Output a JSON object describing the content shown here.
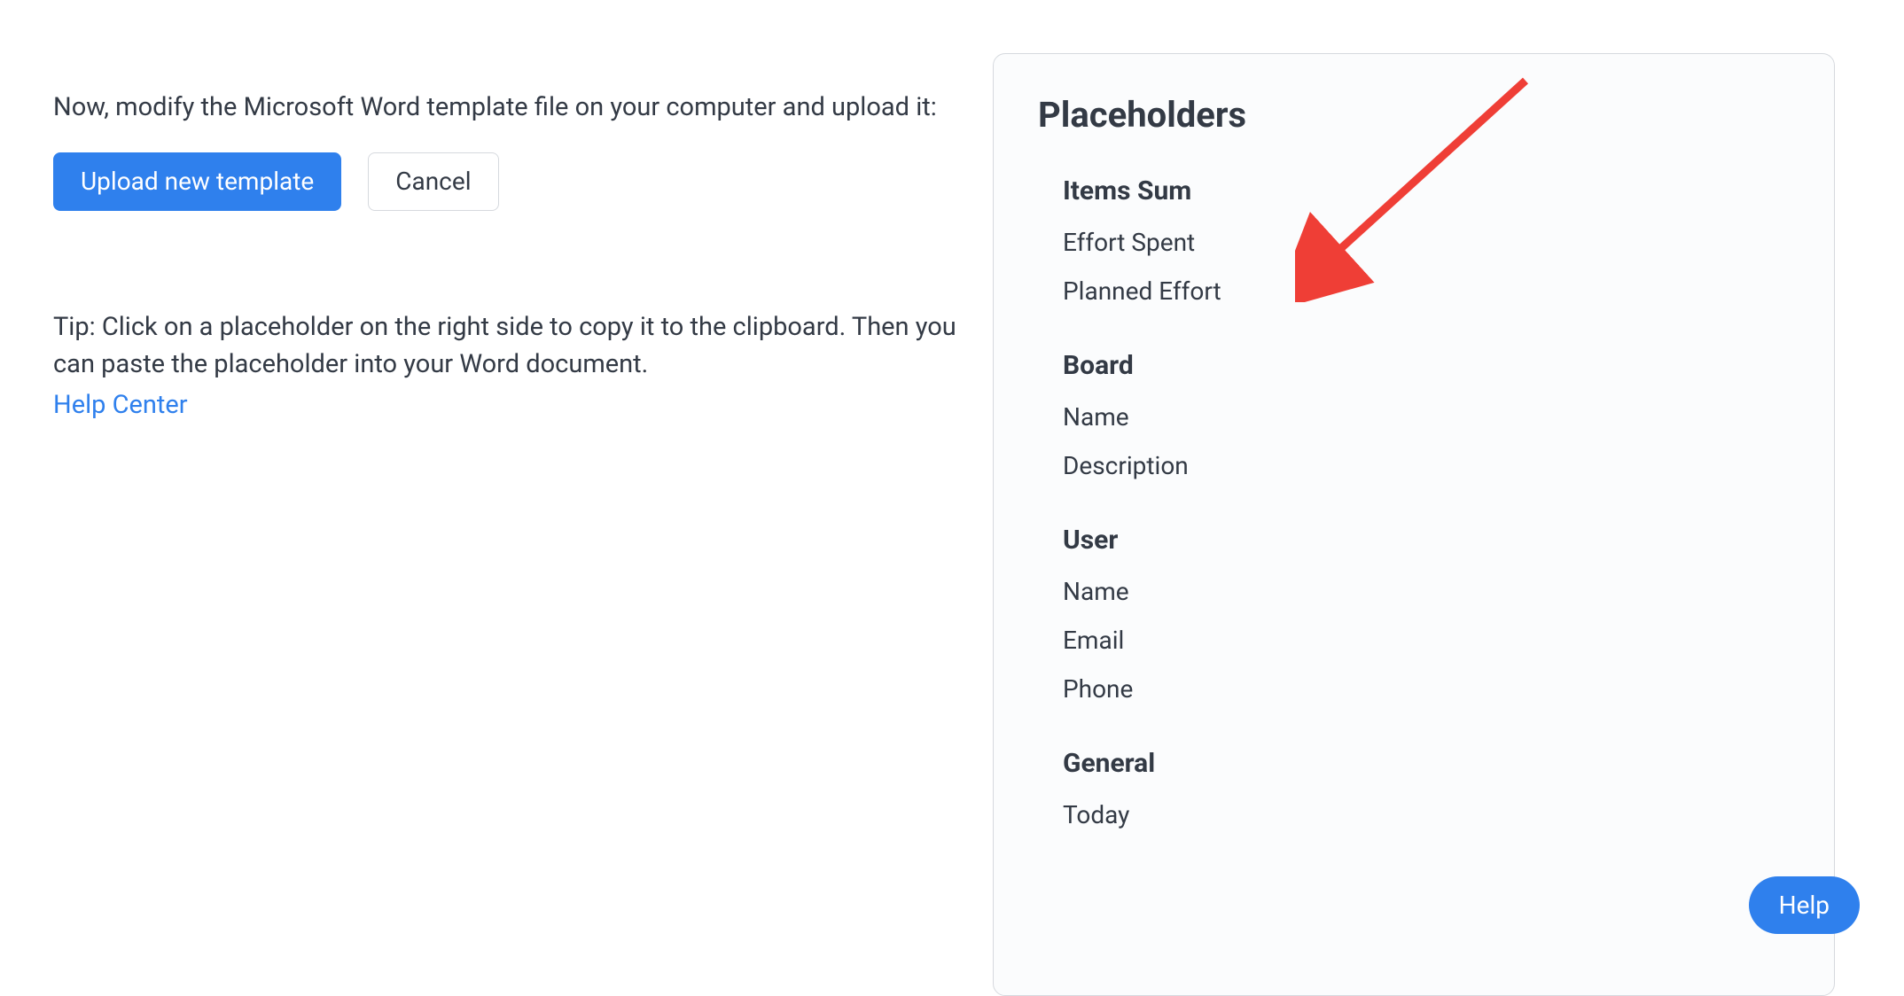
{
  "instruction": "Now, modify the Microsoft Word template file on your computer and upload it:",
  "buttons": {
    "upload": "Upload new template",
    "cancel": "Cancel"
  },
  "tip": {
    "text": "Tip: Click on a placeholder on the right side to copy it to the clipboard. Then you can paste the placeholder into your Word document.",
    "link_label": "Help Center"
  },
  "panel": {
    "title": "Placeholders",
    "groups": [
      {
        "title": "Items Sum",
        "items": [
          "Effort Spent",
          "Planned Effort"
        ]
      },
      {
        "title": "Board",
        "items": [
          "Name",
          "Description"
        ]
      },
      {
        "title": "User",
        "items": [
          "Name",
          "Email",
          "Phone"
        ]
      },
      {
        "title": "General",
        "items": [
          "Today"
        ]
      }
    ]
  },
  "help_button": "Help",
  "colors": {
    "primary": "#2f80ed",
    "panel_bg": "#fbfcfd",
    "panel_border": "#d6d9de",
    "text": "#333a45",
    "arrow": "#ef3e36"
  }
}
